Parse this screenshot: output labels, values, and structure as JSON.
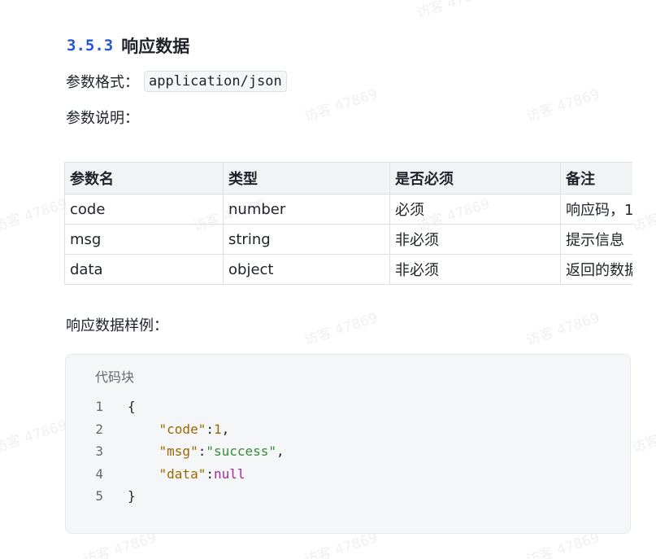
{
  "section": {
    "number": "3.5.3",
    "title": "响应数据"
  },
  "format": {
    "label": "参数格式：",
    "value": "application/json"
  },
  "description_label": "参数说明：",
  "params_table": {
    "headers": [
      "参数名",
      "类型",
      "是否必须",
      "备注"
    ],
    "rows": [
      [
        "code",
        "number",
        "必须",
        "响应码，1"
      ],
      [
        "msg",
        "string",
        "非必须",
        "提示信息"
      ],
      [
        "data",
        "object",
        "非必须",
        "返回的数据"
      ]
    ]
  },
  "sample_label": "响应数据样例：",
  "code_block": {
    "label": "代码块",
    "line_numbers": [
      "1",
      "2",
      "3",
      "4",
      "5"
    ],
    "lines": {
      "l1_open": "{",
      "l2_key": "\"code\"",
      "l2_colon": ":",
      "l2_value": "1",
      "l2_comma": ",",
      "l3_key": "\"msg\"",
      "l3_colon": ":",
      "l3_value": "\"success\"",
      "l3_comma": ",",
      "l4_key": "\"data\"",
      "l4_colon": ":",
      "l4_value": "null",
      "l5_close": "}"
    }
  },
  "watermark_text": "访客 47869",
  "colors": {
    "heading_number": "#2456d6",
    "json_key": "#9a6700",
    "json_string": "#3b8a3b",
    "json_null": "#a626a4",
    "table_header_bg": "#f2f3f5",
    "code_bg": "#f5f6f7"
  }
}
